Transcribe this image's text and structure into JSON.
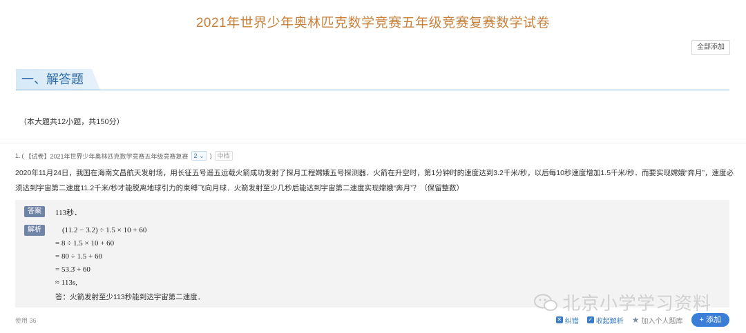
{
  "title": "2021年世界少年奥林匹克数学竞赛五年级竞赛复赛数学试卷",
  "add_all_label": "全部添加",
  "section": {
    "title": "一、解答题",
    "note": "（本大题共12小题，共150分）"
  },
  "question": {
    "number": "1.",
    "paren_open": "(",
    "source_link": "【试卷】2021年世界少年奥林匹克数学竞赛五年级竞赛复赛",
    "version": "2",
    "paren_close": ")",
    "difficulty": "中档",
    "text": "2020年11月24日，我国在海南文昌航天发射场，用长征五号遥五运载火箭成功发射了探月工程嫦娥五号探测器．火箭在升空时，第1分钟时的速度达到3.2千米/秒，以后每10秒速度增加1.5千米/秒．而要实现嫦娥“奔月”，速度必须达到宇宙第二速度11.2千米/秒才能脱离地球引力的束缚飞向月球．火箭发射至少几秒后能达到宇宙第二速度实现嫦娥“奔月”？（保留整数）"
  },
  "answer": {
    "label": "答案",
    "value": "113秒．",
    "analysis_label": "解析",
    "steps": [
      "(11.2 − 3.2) ÷ 1.5 × 10 + 60",
      "= 8 ÷ 1.5 × 10 + 60",
      "= 80 ÷ 1.5 + 60",
      "= 53.3̇ + 60",
      "≈ 113s,"
    ],
    "conclusion": "答：火箭发射至少113秒能到达宇宙第二速度．"
  },
  "watermark": "北京小学学习资料",
  "footer": {
    "usage": "使用 36",
    "report": "纠错",
    "collect": "收起解析",
    "add_bank": "加入个人题库",
    "add": "+ 添加"
  }
}
